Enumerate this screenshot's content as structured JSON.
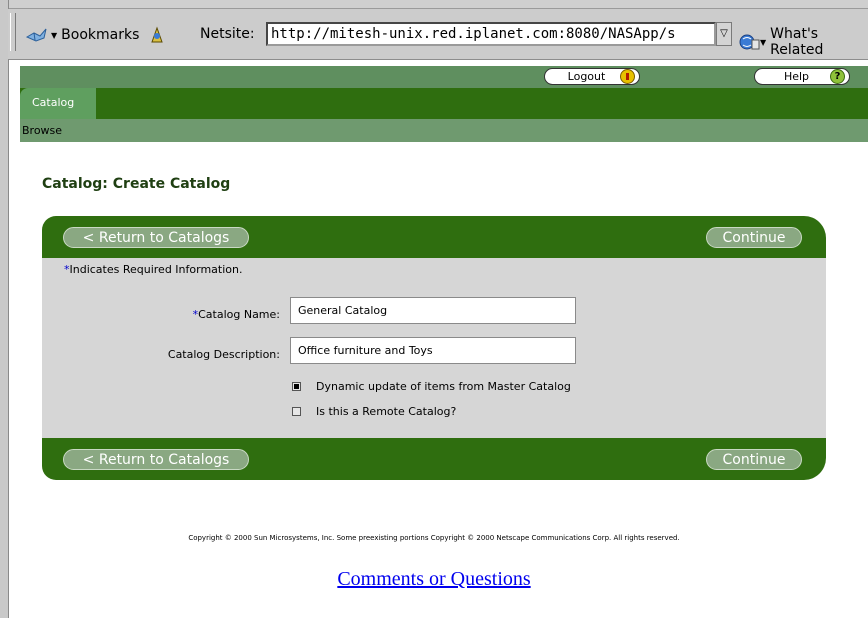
{
  "browser": {
    "bookmarks_label": "Bookmarks",
    "netsite_label": "Netsite:",
    "url": "http://mitesh-unix.red.iplanet.com:8080/NASApp/s",
    "whats_related_label": "What's Related"
  },
  "header": {
    "logout_label": "Logout",
    "help_label": "Help",
    "help_icon_glyph": "?",
    "active_tab": "Catalog",
    "sub_nav": "Browse"
  },
  "page": {
    "title": "Catalog: Create Catalog"
  },
  "form": {
    "return_label": "< Return to Catalogs",
    "continue_label": "Continue",
    "required_star": "*",
    "required_note": "Indicates Required Information.",
    "catalog_name_label": "Catalog Name:",
    "catalog_name_value": "General Catalog",
    "catalog_description_label": "Catalog Description:",
    "catalog_description_value": "Office furniture and Toys",
    "dynamic_update_label": "Dynamic update of items from Master Catalog",
    "dynamic_update_checked": true,
    "remote_catalog_label": "Is this a Remote Catalog?",
    "remote_catalog_checked": false
  },
  "footer": {
    "copyright": "Copyright © 2000 Sun Microsystems, Inc. Some preexisting portions Copyright © 2000 Netscape Communications Corp. All rights reserved.",
    "comments_link": "Comments or Questions"
  },
  "colors": {
    "dark_green": "#2f6e0f",
    "mid_green": "#5f9f5f",
    "button_green": "#8aa882",
    "panel_gray": "#d6d6d6",
    "link_blue": "#0000ee"
  }
}
